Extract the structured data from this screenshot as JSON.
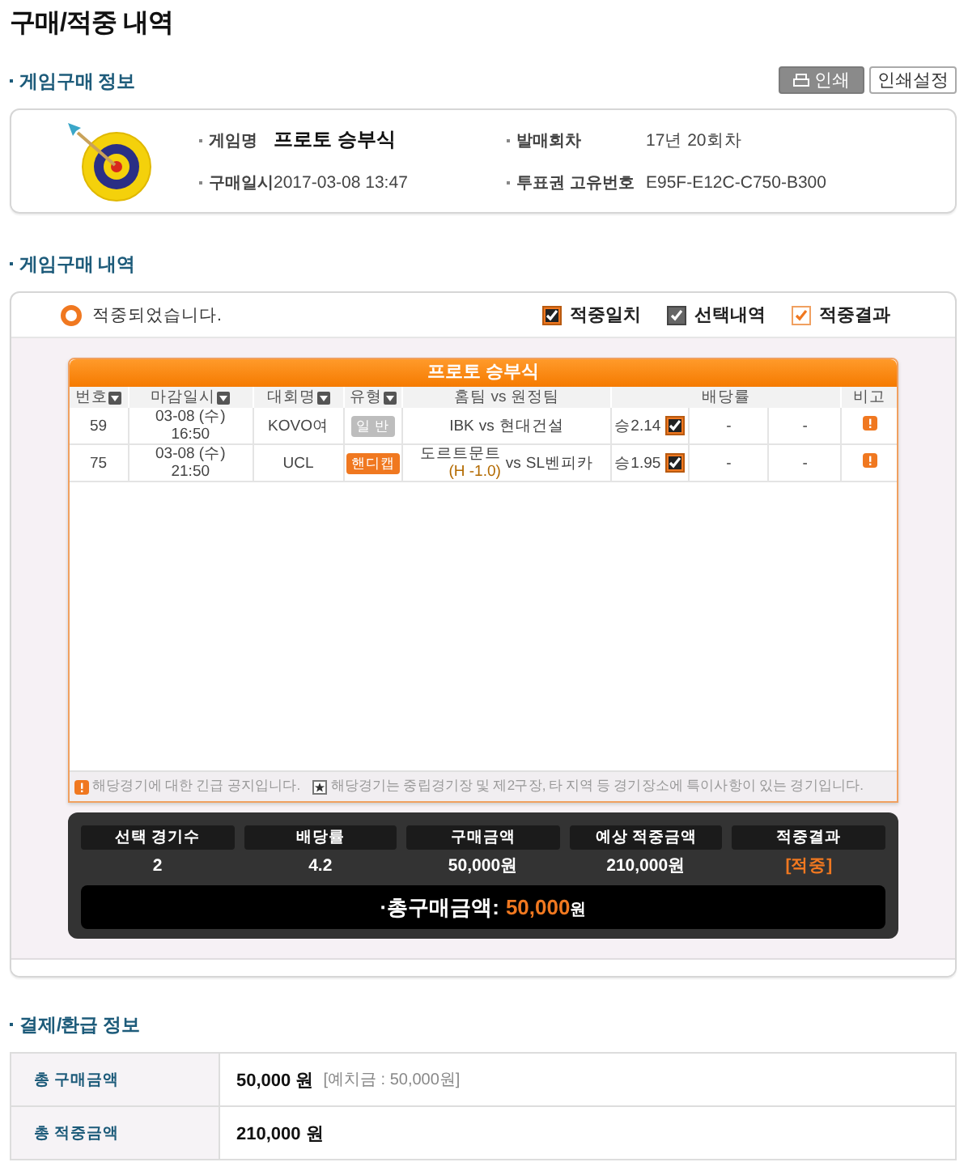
{
  "page_title": "구매/적중 내역",
  "purchase_info": {
    "title": "게임구매 정보",
    "buttons": [
      {
        "kind": "print",
        "label": "인쇄"
      },
      {
        "kind": "settings",
        "label": "인쇄설정"
      }
    ],
    "fields": [
      {
        "label": "게임명",
        "value": "프로토 승부식",
        "emphasis": true
      },
      {
        "label": "발매회차",
        "value": "17년 20회차",
        "emphasis": false
      },
      {
        "label": "구매일시",
        "value": "2017-03-08 13:47",
        "emphasis": false
      },
      {
        "label": "투표권 고유번호",
        "value": "E95F-E12C-C750-B300",
        "emphasis": false
      }
    ]
  },
  "purchase_detail": {
    "title": "게임구매 내역",
    "status": "적중되었습니다.",
    "legend": [
      {
        "kind": "match",
        "label": "적중일치"
      },
      {
        "kind": "selected",
        "label": "선택내역"
      },
      {
        "kind": "result",
        "label": "적중결과"
      }
    ],
    "table": {
      "title": "프로토 승부식",
      "columns": [
        {
          "label": "번호",
          "sortable": true
        },
        {
          "label": "마감일시",
          "sortable": true
        },
        {
          "label": "대회명",
          "sortable": true
        },
        {
          "label": "유형",
          "sortable": true
        },
        {
          "label": "홈팀 vs 원정팀",
          "sortable": false
        },
        {
          "label": "배당률",
          "sortable": false
        },
        {
          "label": "비고",
          "sortable": false
        }
      ],
      "rows": [
        {
          "number": "59",
          "date": "03-08 (수)",
          "time": "16:50",
          "league": "KOVO여",
          "type": {
            "kind": "normal",
            "label": "일 반"
          },
          "home": "IBK",
          "vs": "vs",
          "away": "현대건설",
          "odds_win": "승2.14",
          "win_checked": true,
          "odds_draw": "-",
          "odds_loss": "-",
          "notice": true
        },
        {
          "number": "75",
          "date": "03-08 (수)",
          "time": "21:50",
          "league": "UCL",
          "type": {
            "kind": "handicap",
            "label": "핸디캡"
          },
          "home": "도르트문트",
          "handicap": "(H -1.0)",
          "vs": "vs",
          "away": "SL벤피카",
          "odds_win": "승1.95",
          "win_checked": true,
          "odds_draw": "-",
          "odds_loss": "-",
          "notice": true
        }
      ],
      "notes": [
        {
          "kind": "alert",
          "text": "해당경기에 대한 긴급 공지입니다."
        },
        {
          "kind": "star",
          "text": "해당경기는 중립경기장 및 제2구장, 타 지역 등 경기장소에 특이사항이 있는 경기입니다."
        }
      ]
    },
    "summary": {
      "columns": [
        {
          "label": "선택 경기수",
          "value": "2",
          "kind": "plain"
        },
        {
          "label": "배당률",
          "value": "4.2",
          "kind": "plain"
        },
        {
          "label": "구매금액",
          "value": "50,000원",
          "kind": "plain"
        },
        {
          "label": "예상 적중금액",
          "value": "210,000원",
          "kind": "plain"
        },
        {
          "label": "적중결과",
          "value": "[적중]",
          "kind": "result"
        }
      ],
      "total_label": "·총구매금액:",
      "total_value": "50,000",
      "total_unit": "원"
    }
  },
  "payment": {
    "title": "결제/환급 정보",
    "rows": [
      {
        "label": "총 구매금액",
        "amount": "50,000 원",
        "note": "[예치금 : 50,000원]"
      },
      {
        "label": "총 적중금액",
        "amount": "210,000 원"
      }
    ]
  }
}
